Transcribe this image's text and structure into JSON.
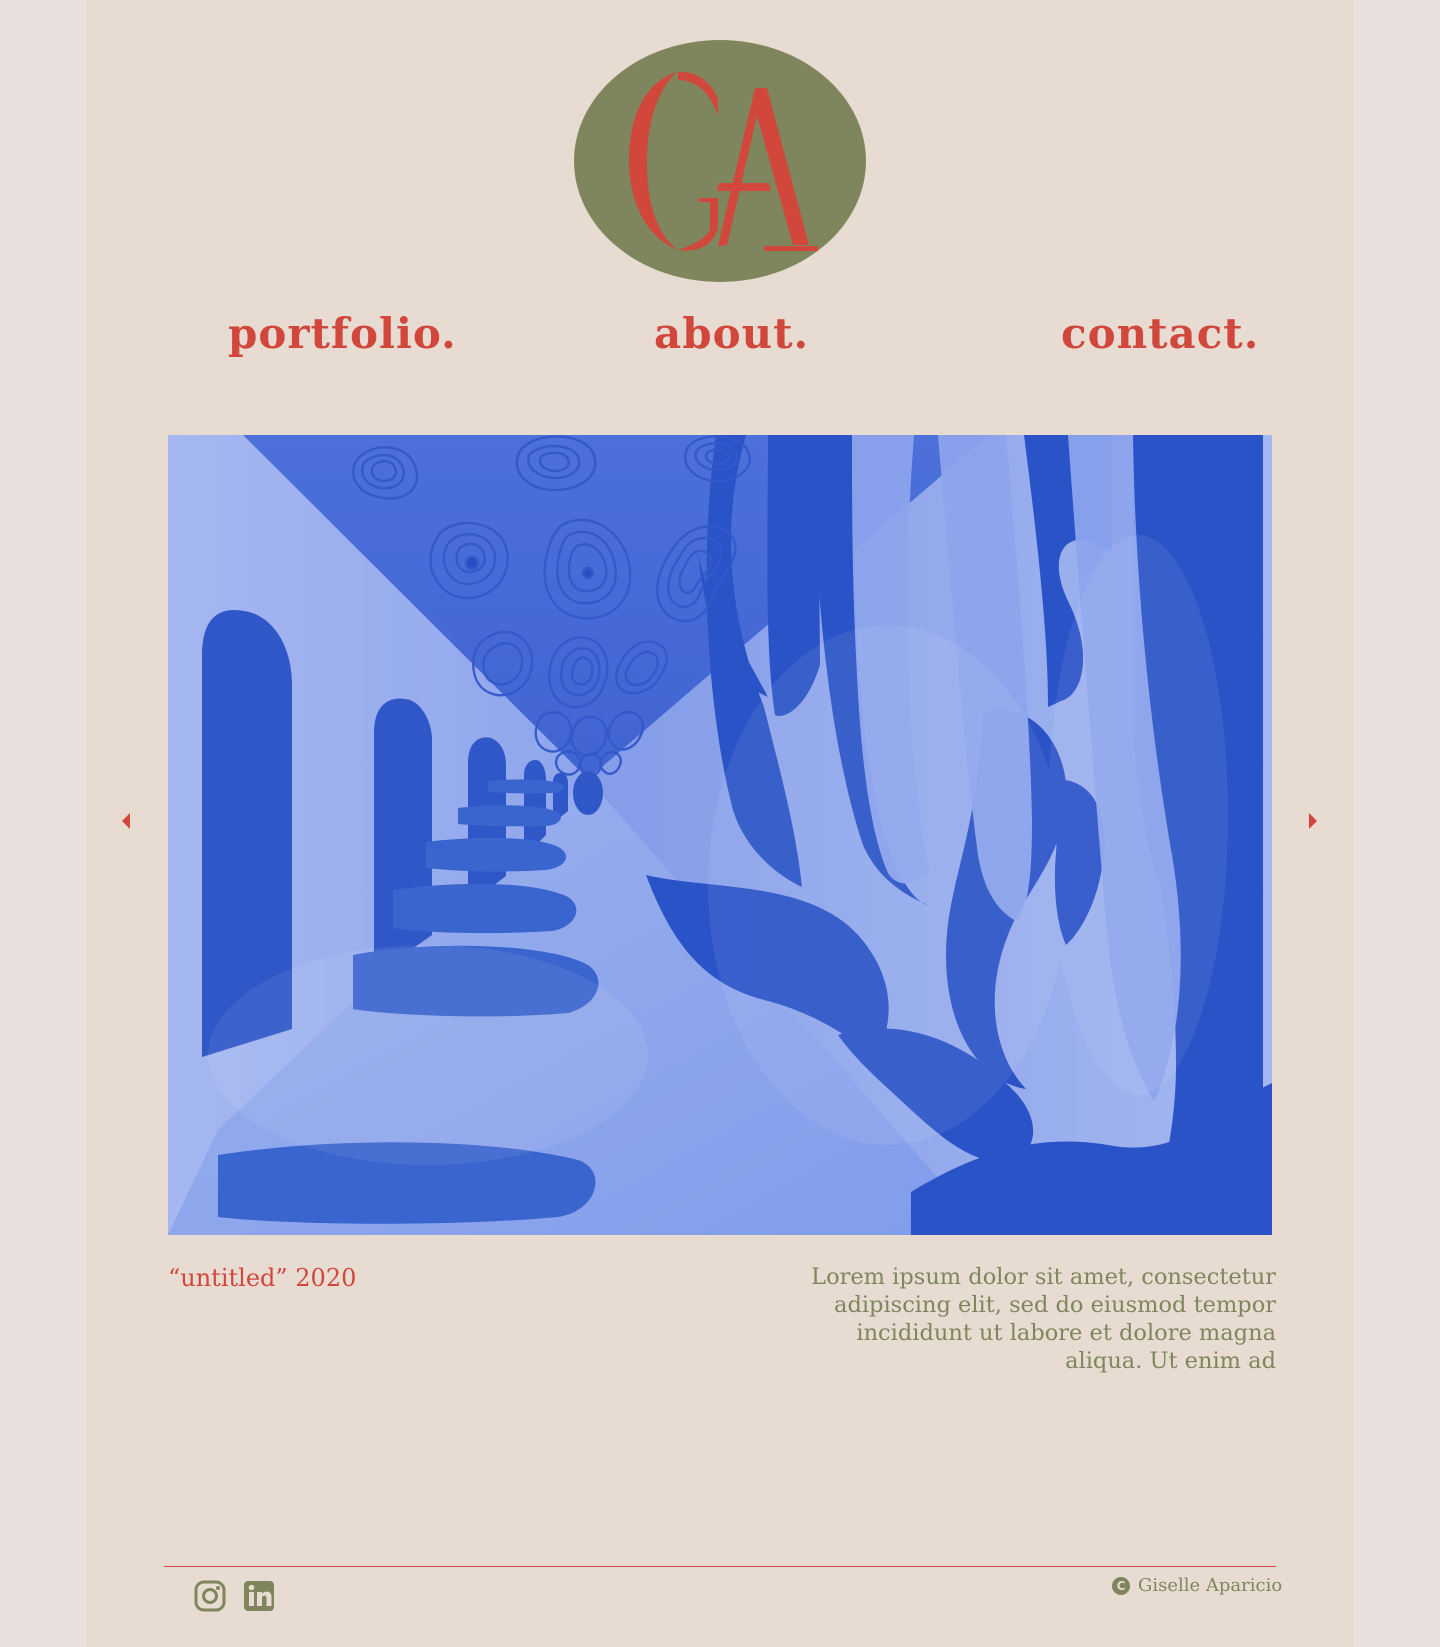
{
  "brand": {
    "initials": "GA",
    "logo_background": "#7f865e",
    "logo_text_color": "#d1473b"
  },
  "navigation": {
    "items": [
      {
        "label": "portfolio."
      },
      {
        "label": "about."
      },
      {
        "label": "contact."
      }
    ]
  },
  "gallery": {
    "caption": "“untitled” 2020",
    "description": "Lorem ipsum dolor sit amet, consectetur adipiscing elit, sed do eiusmod tempor incididunt ut labore et dolore magna aliqua. Ut enim ad",
    "previous_icon": "chevron-left-icon",
    "next_icon": "chevron-right-icon"
  },
  "footer": {
    "social": [
      {
        "platform": "instagram",
        "icon": "instagram-icon"
      },
      {
        "platform": "linkedin",
        "icon": "linkedin-icon"
      }
    ],
    "copyright_symbol": "C",
    "copyright_name": "Giselle Aparicio"
  },
  "colors": {
    "accent": "#d1473b",
    "olive": "#7f865e",
    "panel_background": "#e8dbd1",
    "page_background": "#e9e0dd",
    "artwork_blue": "#2d5ed5"
  }
}
